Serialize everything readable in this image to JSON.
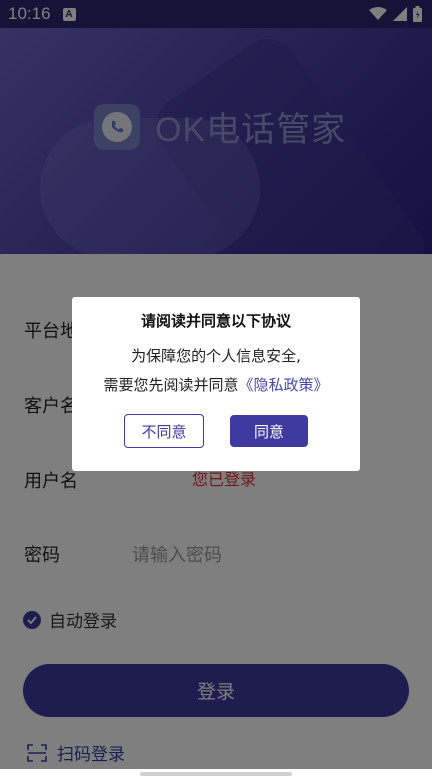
{
  "status_bar": {
    "time": "10:16",
    "notification_icon": "A"
  },
  "hero": {
    "app_name": "OK电话管家"
  },
  "form": {
    "platform_label": "平台地",
    "customer_label": "客户名",
    "username_label": "用户名",
    "username_hint": "您已登录",
    "password_label": "密码",
    "password_placeholder": "请输入密码",
    "auto_login_label": "自动登录",
    "login_button": "登录",
    "scan_login": "扫码登录"
  },
  "dialog": {
    "title": "请阅读并同意以下协议",
    "line1": "为保障您的个人信息安全,",
    "line2_prefix": "需要您先阅读并同意",
    "privacy_link": "《隐私政策》",
    "disagree": "不同意",
    "agree": "同意"
  },
  "colors": {
    "accent": "#3f3aa0",
    "overlay": "rgba(0,0,0,0.5)"
  }
}
